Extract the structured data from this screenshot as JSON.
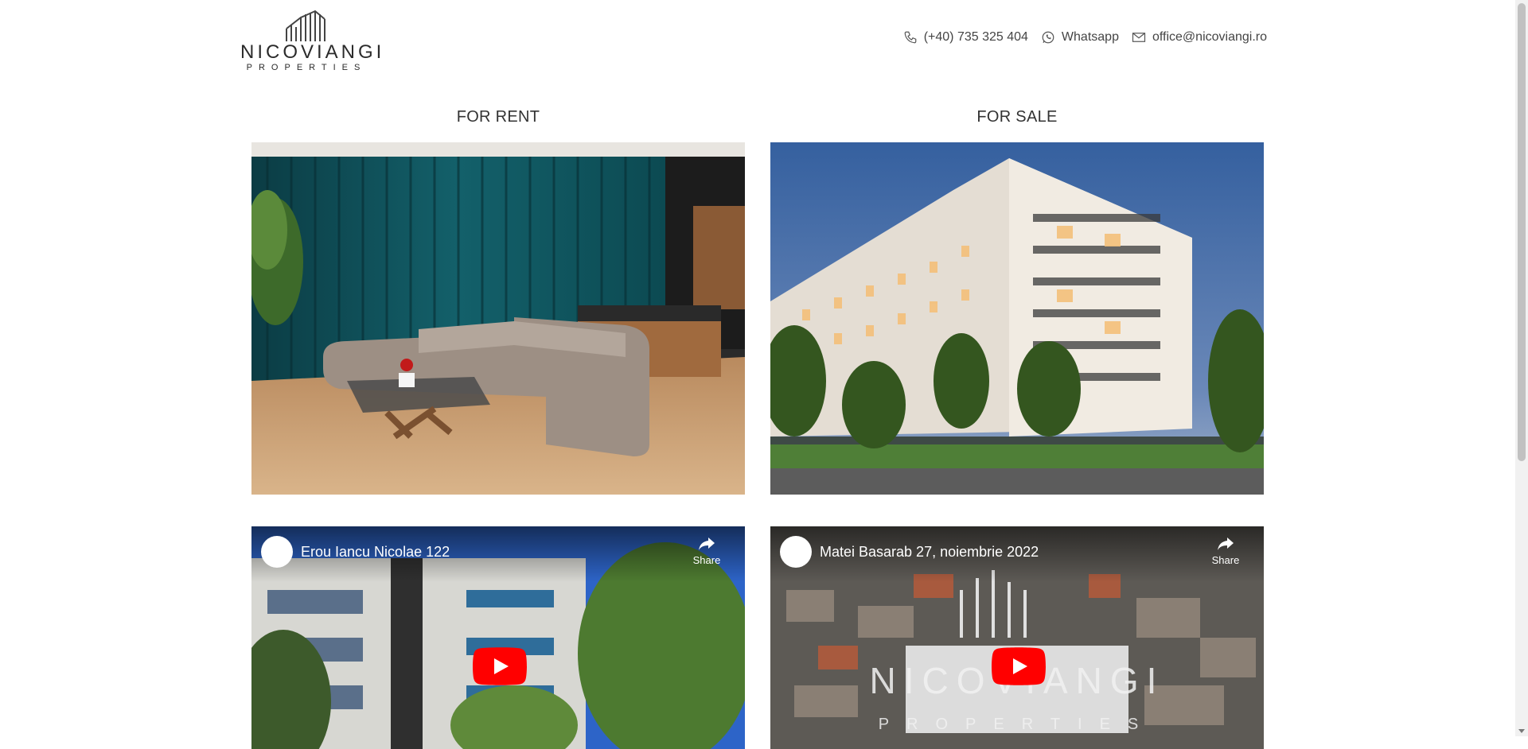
{
  "header": {
    "logo_word": "NICOVIANGI",
    "logo_sub": "PROPERTIES",
    "phone": "(+40) 735 325 404",
    "whatsapp": "Whatsapp",
    "email": "office@nicoviangi.ro"
  },
  "columns": {
    "rent_title": "FOR RENT",
    "sale_title": "FOR SALE"
  },
  "videos": [
    {
      "title": "Erou Iancu Nicolae 122",
      "share": "Share"
    },
    {
      "title": "Matei Basarab 27, noiembrie 2022",
      "share": "Share"
    }
  ],
  "colors": {
    "youtube_red": "#ff0000",
    "text": "#333333",
    "curtain": "#0e4d55",
    "sky": "#3f6fb0"
  }
}
